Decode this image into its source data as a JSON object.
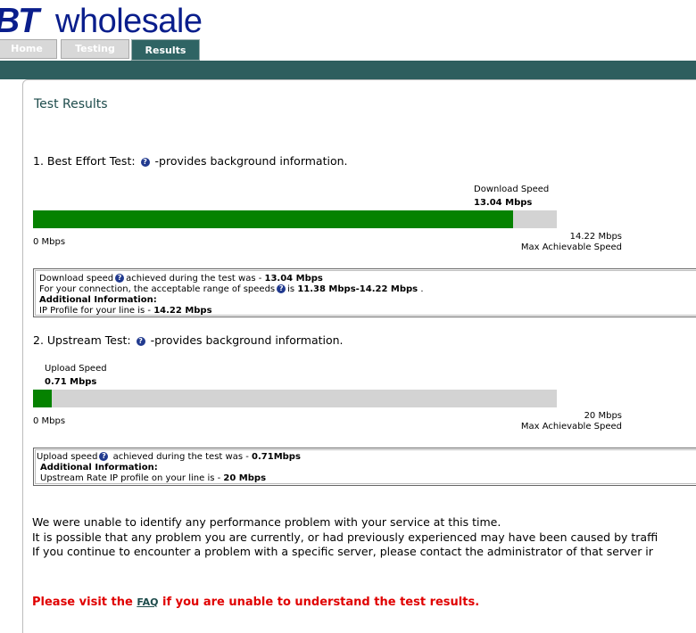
{
  "brand": {
    "bt": "BT",
    "rest": "wholesale",
    "color": "#0a1e8c"
  },
  "nav": {
    "tabs": [
      {
        "label": "Home"
      },
      {
        "label": "Testing"
      },
      {
        "label": "Results"
      }
    ],
    "active": "Results"
  },
  "page_title": "Test Results",
  "best_effort": {
    "heading_prefix": "1. Best Effort Test:",
    "heading_suffix": "-provides background information.",
    "speed_label": "Download Speed",
    "speed_value": "13.04 Mbps",
    "min_label": "0 Mbps",
    "max_value": "14.22 Mbps",
    "max_label": "Max Achievable Speed",
    "fill_fraction": 0.917,
    "info": {
      "line1_a": "Download speed",
      "line1_b": "achieved during the test was - ",
      "line1_val": "13.04 Mbps",
      "line2_a": "For your connection, the acceptable range of speeds",
      "line2_b": "is ",
      "line2_val": "11.38 Mbps-14.22 Mbps",
      "line2_end": " .",
      "additional": "Additional Information:",
      "line4_a": "IP Profile for your line is - ",
      "line4_val": "14.22 Mbps"
    }
  },
  "upstream": {
    "heading_prefix": "2. Upstream Test:",
    "heading_suffix": "-provides background information.",
    "speed_label": "Upload Speed",
    "speed_value": "0.71 Mbps",
    "min_label": "0 Mbps",
    "max_value": "20 Mbps",
    "max_label": "Max Achievable Speed",
    "fill_fraction": 0.0355,
    "info": {
      "line1_a": "Upload speed",
      "line1_b": " achieved during the test was - ",
      "line1_val": "0.71Mbps",
      "additional": "Additional Information:",
      "line3_a": "Upstream Rate IP profile on your line is - ",
      "line3_val": "20 Mbps"
    }
  },
  "messages": [
    "We were unable to identify any performance problem with your service at this time.",
    "It is possible that any problem you are currently, or had previously experienced may have been caused by traffi",
    "If you continue to encounter a problem with a specific server, please contact the administrator of that server ir"
  ],
  "faq": {
    "before": "Please visit the ",
    "link": "FAQ",
    "after": " if you are unable to understand the test results."
  },
  "colors": {
    "bar_fill": "#058200",
    "bar_track": "#d3d3d3",
    "nav_band": "#2e5e5e",
    "faq_text": "#e00000"
  }
}
